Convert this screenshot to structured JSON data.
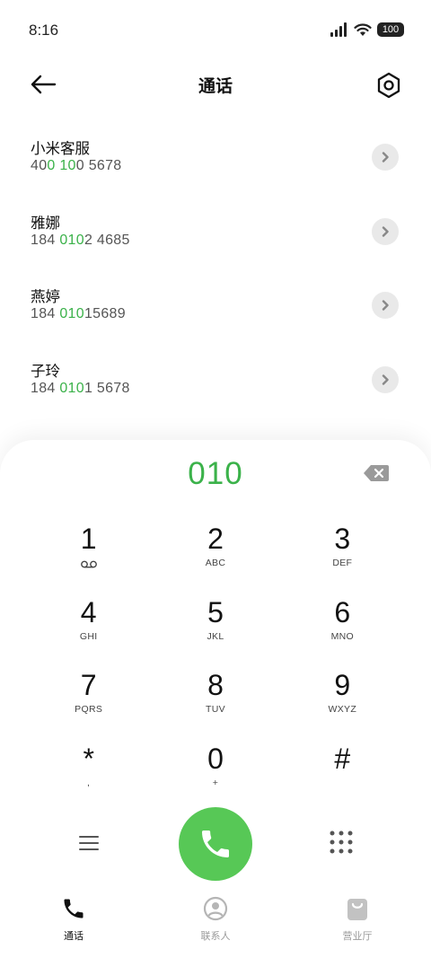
{
  "status": {
    "time": "8:16",
    "battery": "100"
  },
  "header": {
    "title": "通话"
  },
  "results": [
    {
      "name": "小米客服",
      "number_parts": [
        "40",
        "0 10",
        "0 5678"
      ]
    },
    {
      "name": "雅娜",
      "number_parts": [
        "184 ",
        "010",
        "2 4685"
      ]
    },
    {
      "name": "燕婷",
      "number_parts": [
        "184 ",
        "010",
        "15689"
      ]
    },
    {
      "name": "子玲",
      "number_parts": [
        "184 ",
        "010",
        "1 5678"
      ]
    }
  ],
  "dialer": {
    "number": "010",
    "keys": [
      {
        "digit": "1",
        "letters": ""
      },
      {
        "digit": "2",
        "letters": "ABC"
      },
      {
        "digit": "3",
        "letters": "DEF"
      },
      {
        "digit": "4",
        "letters": "GHI"
      },
      {
        "digit": "5",
        "letters": "JKL"
      },
      {
        "digit": "6",
        "letters": "MNO"
      },
      {
        "digit": "7",
        "letters": "PQRS"
      },
      {
        "digit": "8",
        "letters": "TUV"
      },
      {
        "digit": "9",
        "letters": "WXYZ"
      },
      {
        "digit": "*",
        "letters": ","
      },
      {
        "digit": "0",
        "letters": "+"
      },
      {
        "digit": "#",
        "letters": ""
      }
    ]
  },
  "nav": [
    {
      "label": "通话",
      "icon": "phone-icon",
      "active": true
    },
    {
      "label": "联系人",
      "icon": "contacts-icon",
      "active": false
    },
    {
      "label": "营业厅",
      "icon": "shopping-bag-icon",
      "active": false
    }
  ],
  "colors": {
    "accent": "#3bb24a",
    "call_button": "#57c856"
  }
}
